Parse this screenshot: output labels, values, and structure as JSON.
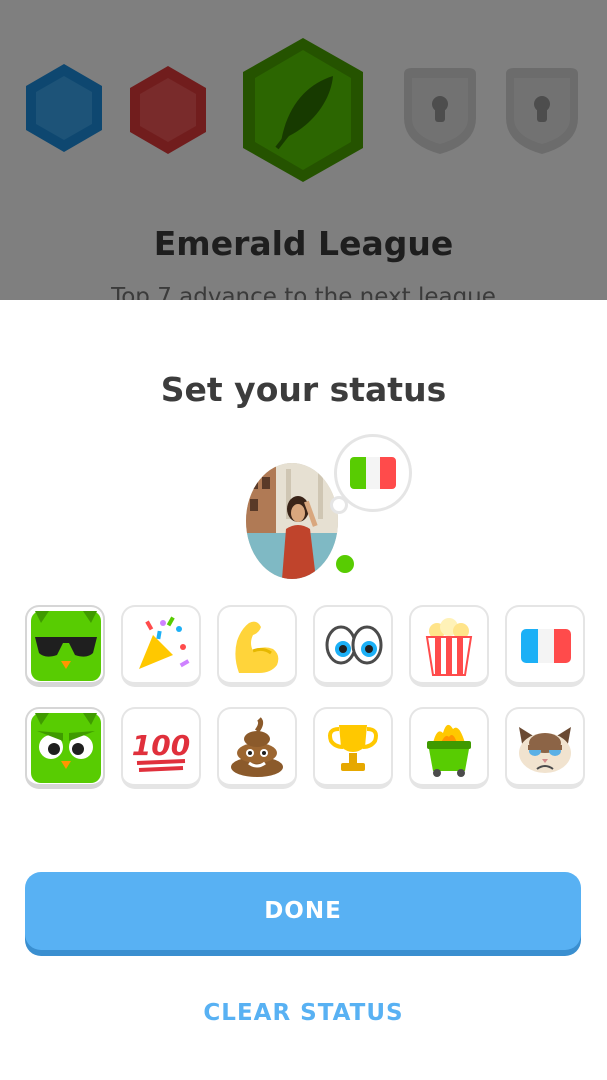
{
  "background": {
    "league_name": "Emerald League",
    "league_subtitle": "Top 7 advance to the next league",
    "badges": [
      "sapphire-badge-icon",
      "ruby-badge-icon",
      "emerald-feather-badge-icon",
      "locked-badge-icon",
      "locked-badge-icon"
    ]
  },
  "sheet": {
    "title": "Set your status",
    "current_status": "italy-flag-icon",
    "online": true
  },
  "statuses": [
    {
      "icon": "owl-sunglasses-icon",
      "selected": true
    },
    {
      "icon": "party-popper-icon",
      "selected": false
    },
    {
      "icon": "flexed-biceps-icon",
      "selected": false
    },
    {
      "icon": "eyes-icon",
      "selected": false
    },
    {
      "icon": "popcorn-icon",
      "selected": false
    },
    {
      "icon": "france-flag-icon",
      "selected": false
    },
    {
      "icon": "angry-owl-icon",
      "selected": true
    },
    {
      "icon": "hundred-points-icon",
      "selected": false
    },
    {
      "icon": "pile-of-poo-icon",
      "selected": false
    },
    {
      "icon": "trophy-icon",
      "selected": false
    },
    {
      "icon": "dumpster-fire-icon",
      "selected": false
    },
    {
      "icon": "grumpy-cat-icon",
      "selected": false
    }
  ],
  "actions": {
    "done_label": "DONE",
    "clear_label": "CLEAR STATUS"
  },
  "colors": {
    "accent_blue": "#58b1f3",
    "online_green": "#58cc02",
    "emerald": "#58cc02"
  }
}
